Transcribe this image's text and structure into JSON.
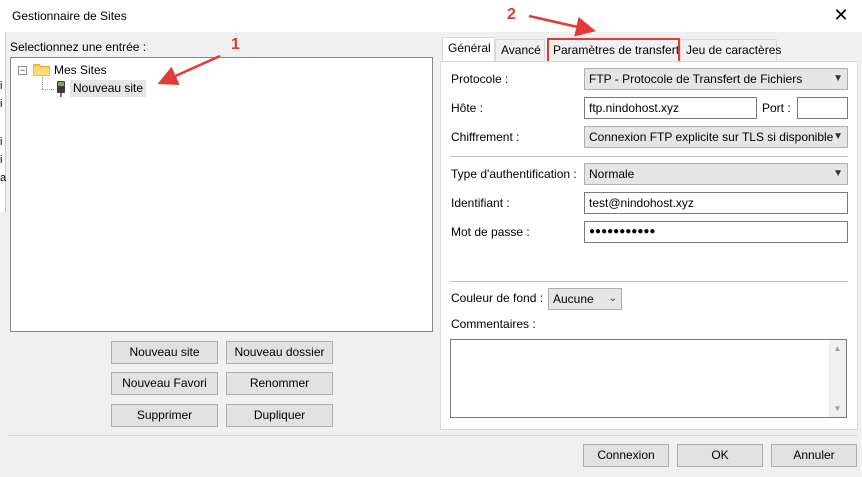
{
  "window": {
    "title": "Gestionnaire de Sites",
    "close_glyph": "✕"
  },
  "left_strip_chars": [
    "i",
    "i",
    "i",
    "i",
    "a"
  ],
  "tree": {
    "label": "Selectionnez une entrée :",
    "root_label": "Mes Sites",
    "expander": "−",
    "selected_item": "Nouveau site"
  },
  "left_buttons": {
    "new_site": "Nouveau site",
    "new_folder": "Nouveau dossier",
    "new_bookmark": "Nouveau Favori",
    "rename": "Renommer",
    "delete": "Supprimer",
    "duplicate": "Dupliquer"
  },
  "tabs": [
    {
      "label": "Général",
      "active": true
    },
    {
      "label": "Avancé",
      "active": false
    },
    {
      "label": "Paramètres de transfert",
      "active": false,
      "highlighted": true
    },
    {
      "label": "Jeu de caractères",
      "active": false
    }
  ],
  "general": {
    "protocol_label": "Protocole :",
    "protocol_value": "FTP - Protocole de Transfert de Fichiers",
    "host_label": "Hôte :",
    "host_value": "ftp.nindohost.xyz",
    "port_label": "Port :",
    "port_value": "",
    "encryption_label": "Chiffrement :",
    "encryption_value": "Connexion FTP explicite sur TLS si disponible",
    "auth_type_label": "Type d'authentification :",
    "auth_type_value": "Normale",
    "user_label": "Identifiant :",
    "user_value": "test@nindohost.xyz",
    "password_label": "Mot de passe :",
    "password_value": "●●●●●●●●●●●",
    "bg_color_label": "Couleur de fond :",
    "bg_color_value": "Aucune",
    "comments_label": "Commentaires :"
  },
  "footer_buttons": {
    "connect": "Connexion",
    "ok": "OK",
    "cancel": "Annuler"
  },
  "annotations": {
    "marker_1": "1",
    "marker_2": "2",
    "color": "#e53935"
  },
  "icons": {
    "folder": "folder-icon",
    "site": "site-icon",
    "dropdown": "chevron-down-icon",
    "scroll_up": "scroll-up-icon",
    "scroll_down": "scroll-down-icon"
  }
}
